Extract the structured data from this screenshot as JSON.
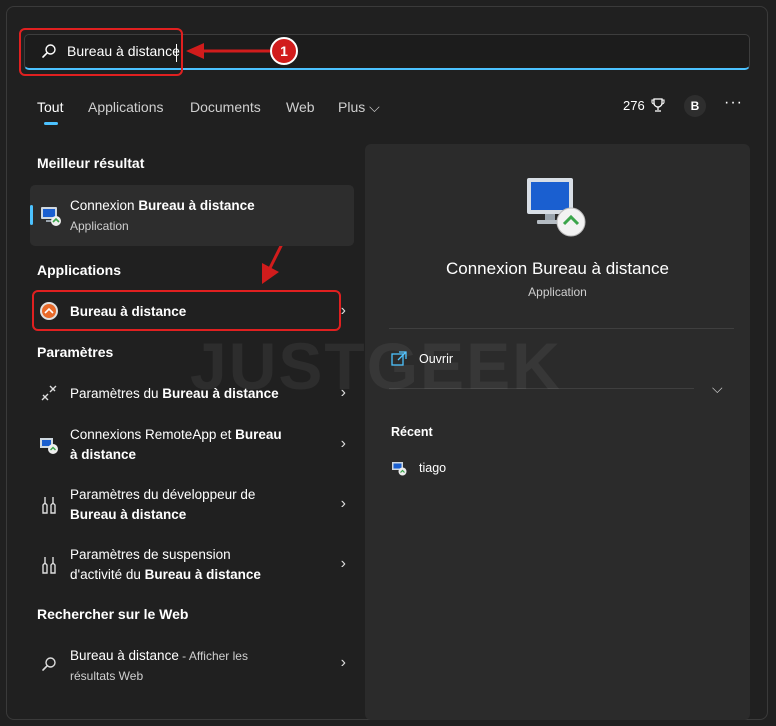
{
  "search": {
    "value": "Bureau à distance",
    "icon": "search-icon"
  },
  "annotation": {
    "badge": "1",
    "color": "#e02020"
  },
  "tabs": [
    {
      "label": "Tout",
      "active": true
    },
    {
      "label": "Applications"
    },
    {
      "label": "Documents"
    },
    {
      "label": "Web"
    },
    {
      "label": "Plus ⌵"
    }
  ],
  "header_right": {
    "points": "276",
    "avatar": "B",
    "more": "···"
  },
  "best_result": {
    "section": "Meilleur résultat",
    "title_prefix": "Connexion ",
    "title_bold": "Bureau à distance",
    "subtitle": "Application"
  },
  "applications": {
    "section": "Applications",
    "item_label": "Bureau à distance"
  },
  "settings": {
    "section": "Paramètres",
    "items": [
      {
        "prefix": "Paramètres du ",
        "bold": "Bureau à distance",
        "line2": ""
      },
      {
        "prefix": "Connexions RemoteApp et ",
        "bold": "Bureau",
        "line2": "à distance"
      },
      {
        "prefix": "Paramètres du développeur de",
        "bold": "",
        "line2": "Bureau à distance"
      },
      {
        "prefix": "Paramètres de suspension",
        "bold": "",
        "line2_prefix": "d'activité du ",
        "line2": "Bureau à distance"
      }
    ]
  },
  "web": {
    "section": "Rechercher sur le Web",
    "query": "Bureau à distance",
    "hint": " - Afficher les",
    "hint2": "résultats Web"
  },
  "detail": {
    "title": "Connexion Bureau à distance",
    "subtitle": "Application",
    "action": "Ouvrir",
    "recent_label": "Récent",
    "recent_item": "tiago"
  },
  "watermark": "JUSTGEEK",
  "colors": {
    "accent": "#4cc2ff",
    "background": "#202020",
    "panel": "#2b2b2b",
    "annotation": "#e02020"
  }
}
